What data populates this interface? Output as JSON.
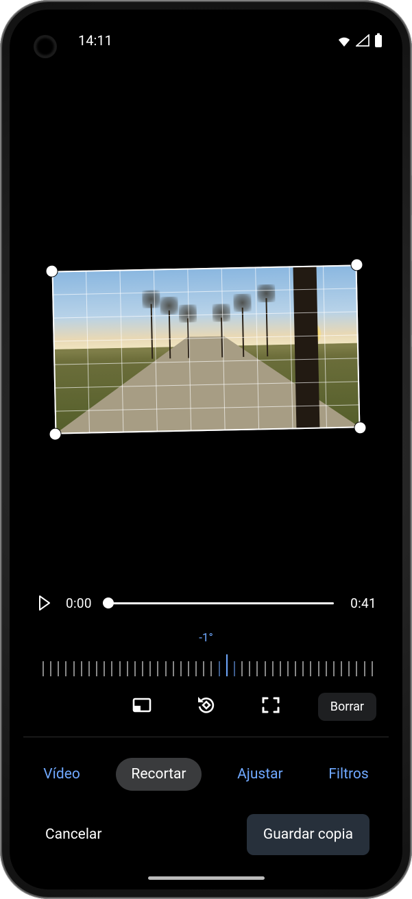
{
  "status": {
    "time": "14:11"
  },
  "rotation": {
    "label": "-1°",
    "value_deg": -1
  },
  "timeline": {
    "current": "0:00",
    "duration": "0:41",
    "progress_pct": 0
  },
  "crop_tools": {
    "clear": "Borrar"
  },
  "tabs": {
    "video": "Vídeo",
    "crop": "Recortar",
    "adjust": "Ajustar",
    "filters": "Filtros",
    "active": "crop"
  },
  "actions": {
    "cancel": "Cancelar",
    "save_copy": "Guardar copia"
  },
  "icons": {
    "wifi": "wifi-icon",
    "signal": "cell-signal-icon",
    "battery": "battery-full-icon",
    "play": "play-icon",
    "aspect": "aspect-ratio-icon",
    "rotate": "rotate-ccw-icon",
    "expand": "expand-frame-icon"
  }
}
